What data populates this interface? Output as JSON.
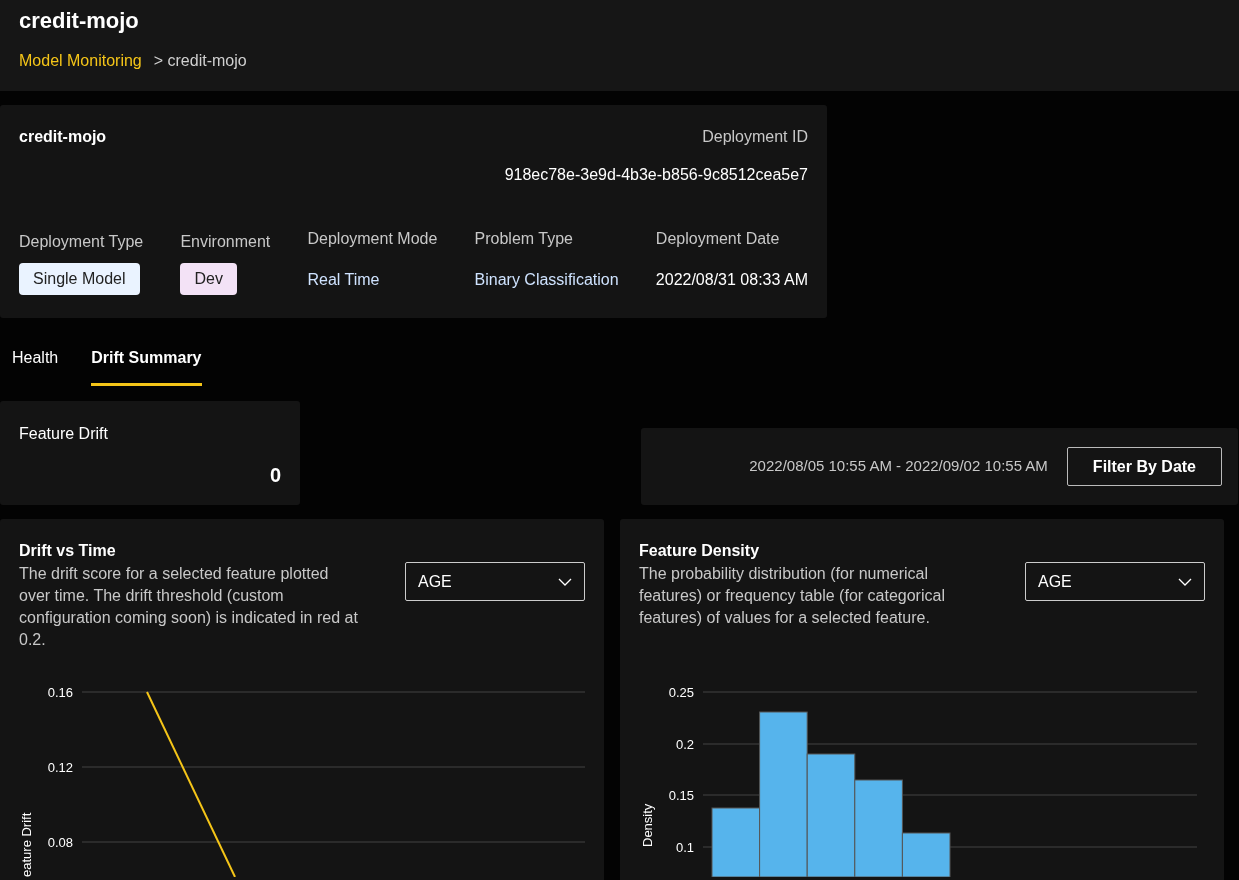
{
  "header": {
    "title": "credit-mojo",
    "breadcrumb": [
      {
        "label": "Model Monitoring",
        "kind": "link"
      },
      {
        "label": "> credit-mojo",
        "kind": "current"
      }
    ]
  },
  "deployment": {
    "name": "credit-mojo",
    "id_label": "Deployment ID",
    "id": "918ec78e-3e9d-4b3e-b856-9c8512cea5e7",
    "fields": [
      {
        "label": "Deployment Type",
        "value": "Single Model",
        "kind": "badge",
        "color": "#eaf3ff"
      },
      {
        "label": "Environment",
        "value": "Dev",
        "kind": "badge",
        "color": "#f3e2f6"
      },
      {
        "label": "Deployment Mode",
        "value": "Real Time",
        "kind": "text"
      },
      {
        "label": "Problem Type",
        "value": "Binary Classification",
        "kind": "text"
      },
      {
        "label": "Deployment Date",
        "value": "2022/08/31 08:33 AM",
        "kind": "date"
      }
    ]
  },
  "tabs": [
    {
      "label": "Health",
      "selected": false
    },
    {
      "label": "Drift Summary",
      "selected": true
    }
  ],
  "feature_drift": {
    "label": "Feature Drift",
    "value": "0"
  },
  "date_filter": {
    "range": "2022/08/05 10:55 AM - 2022/09/02 10:55 AM",
    "button": "Filter By Date"
  },
  "charts": [
    {
      "title": "Drift vs Time",
      "description": "The drift score for a selected feature plotted over time. The drift threshold (custom configuration coming soon) is indicated in red at 0.2.",
      "select": "AGE",
      "plot": {
        "kind": "line",
        "axis_title": "eature Drift",
        "ticks": [
          "0.16",
          "0.12",
          "0.08"
        ]
      }
    },
    {
      "title": "Feature Density",
      "description": "The probability distribution (for numerical features) or frequency table (for categorical features) of values for a selected feature.",
      "select": "AGE",
      "plot": {
        "kind": "histogram",
        "axis_title": "Density",
        "ticks": [
          "0.25",
          "0.2",
          "0.15",
          "0.1"
        ]
      }
    }
  ]
}
